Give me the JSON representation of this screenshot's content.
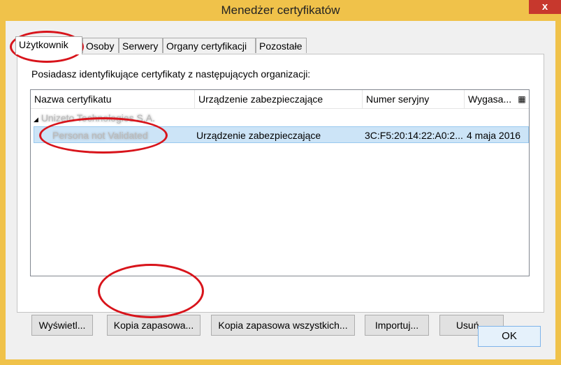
{
  "window": {
    "title": "Menedżer certyfikatów",
    "close_symbol": "x"
  },
  "tabs": [
    {
      "label": "Użytkownik",
      "active": true
    },
    {
      "label": "Osoby"
    },
    {
      "label": "Serwery"
    },
    {
      "label": "Organy certyfikacji"
    },
    {
      "label": "Pozostałe"
    }
  ],
  "panel": {
    "description": "Posiadasz identyfikujące certyfikaty z następujących organizacji:"
  },
  "table": {
    "columns": [
      "Nazwa certyfikatu",
      "Urządzenie zabezpieczające",
      "Numer seryjny",
      "Wygasa..."
    ],
    "group": {
      "toggle": "◢",
      "name": "Unizeto Technologies S.A."
    },
    "rows": [
      {
        "name": "Persona not Validated",
        "device": "Urządzenie zabezpieczające",
        "serial": "3C:F5:20:14:22:A0:2...",
        "expires": "4 maja 2016"
      }
    ]
  },
  "buttons": {
    "view": "Wyświetl...",
    "backup": "Kopia zapasowa...",
    "backup_all": "Kopia zapasowa wszystkich...",
    "import": "Importuj...",
    "delete": "Usuń...",
    "ok": "OK"
  },
  "colors": {
    "accent_border": "#f0c24a",
    "selection": "#cce4f7",
    "annotation": "#d8141b"
  }
}
